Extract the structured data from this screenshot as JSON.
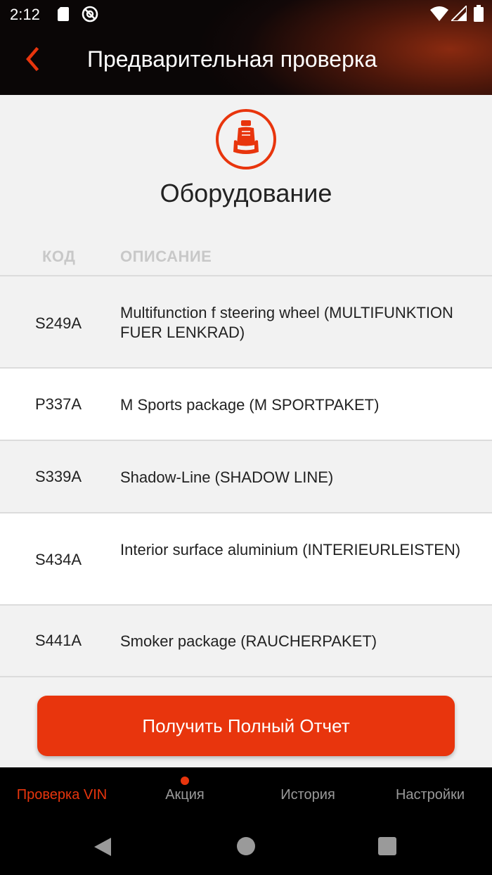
{
  "status_bar": {
    "time": "2:12",
    "icons": [
      "sd-card-icon",
      "do-not-disturb-icon",
      "wifi-icon",
      "signal-icon",
      "battery-icon"
    ]
  },
  "app_bar": {
    "title": "Предварительная проверка",
    "back_icon": "chevron-left-icon"
  },
  "section": {
    "icon": "car-seat-icon",
    "title": "Оборудование"
  },
  "table": {
    "headers": {
      "code": "КОД",
      "description": "ОПИСАНИЕ"
    },
    "rows": [
      {
        "code": "S249A",
        "description": "Multifunction f steering wheel (MULTIFUNKTION FUER LENKRAD)"
      },
      {
        "code": "P337A",
        "description": "M Sports package (M SPORTPAKET)"
      },
      {
        "code": "S339A",
        "description": "Shadow-Line (SHADOW LINE)"
      },
      {
        "code": "S434A",
        "description": "Interior surface aluminium (INTERIEURLEISTEN)"
      },
      {
        "code": "S441A",
        "description": "Smoker package (RAUCHERPAKET)"
      }
    ]
  },
  "cta": {
    "label": "Получить Полный Отчет"
  },
  "bottom_nav": {
    "items": [
      {
        "label": "Проверка VIN",
        "active": true
      },
      {
        "label": "Акция",
        "badge": true
      },
      {
        "label": "История"
      },
      {
        "label": "Настройки"
      }
    ]
  },
  "system_nav": {
    "icons": [
      "back-triangle-icon",
      "home-circle-icon",
      "recents-square-icon"
    ]
  },
  "colors": {
    "accent": "#e8350d",
    "background": "#f2f2f2",
    "nav_bg": "#000000"
  }
}
